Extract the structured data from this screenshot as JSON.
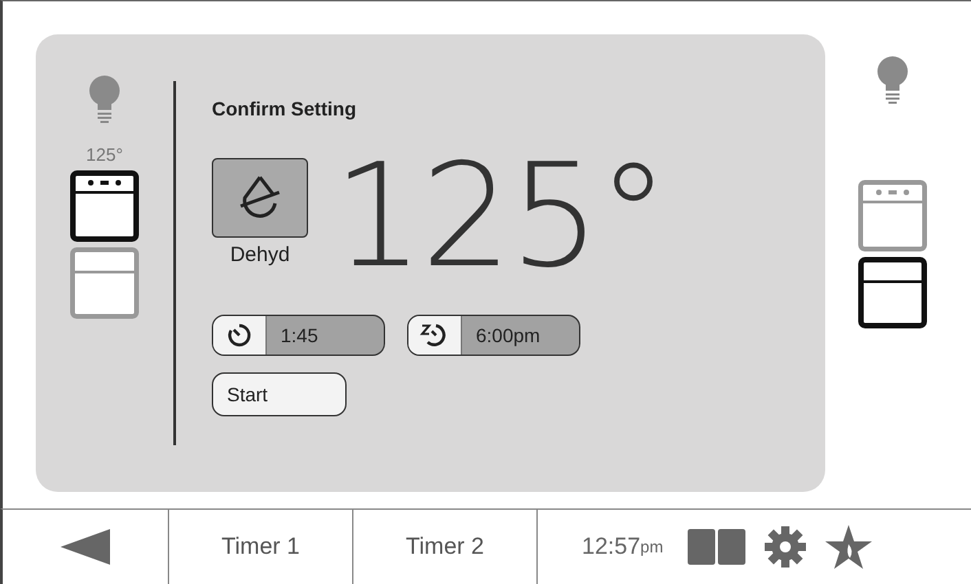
{
  "left_panel": {
    "light_on": false,
    "temperature": "125°",
    "ovens": [
      {
        "kind": "upper",
        "selected": true
      },
      {
        "kind": "lower",
        "selected": false
      }
    ]
  },
  "dialog": {
    "title": "Confirm Setting",
    "mode": {
      "label": "Dehyd"
    },
    "temperature": "125°",
    "timers": [
      {
        "kind": "cook",
        "value": "1:45"
      },
      {
        "kind": "delay",
        "value": "6:00pm"
      }
    ],
    "start_button": "Start"
  },
  "right_panel": {
    "light_on": false,
    "ovens": [
      {
        "kind": "upper",
        "selected": false
      },
      {
        "kind": "lower",
        "selected": true
      }
    ]
  },
  "bottom_bar": {
    "tabs": [
      {
        "label": "Timer 1"
      },
      {
        "label": "Timer 2"
      }
    ],
    "time": "12:57",
    "time_suffix": "pm"
  }
}
